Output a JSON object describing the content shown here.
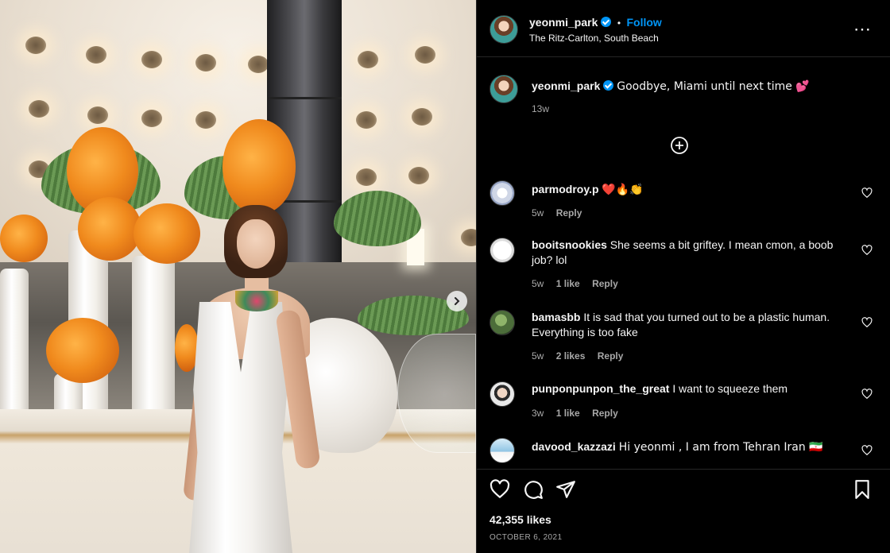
{
  "post": {
    "username": "yeonmi_park",
    "follow_label": "Follow",
    "separator": "•",
    "location": "The Ritz-Carlton, South Beach",
    "caption": "Goodbye, Miami until next time 💕",
    "caption_age": "13w",
    "more_icon": "⋯"
  },
  "comments": [
    {
      "username": "parmodroy.p",
      "text": "❤️🔥👏",
      "age": "5w",
      "likes": "",
      "reply": "Reply"
    },
    {
      "username": "booitsnookies",
      "text": "She seems a bit griftey. I mean cmon, a boob job? lol",
      "age": "5w",
      "likes": "1 like",
      "reply": "Reply"
    },
    {
      "username": "bamasbb",
      "text": "It is sad that you turned out to be a plastic human. Everything is too fake",
      "age": "5w",
      "likes": "2 likes",
      "reply": "Reply"
    },
    {
      "username": "punponpunpon_the_great",
      "text": "I want to squeeze them",
      "age": "3w",
      "likes": "1 like",
      "reply": "Reply"
    },
    {
      "username": "davood_kazzazi",
      "text": "Hi yeonmi , I am from Tehran Iran 🇮🇷",
      "age": "",
      "likes": "",
      "reply": ""
    }
  ],
  "footer": {
    "likes": "42,355 likes",
    "date": "OCTOBER 6, 2021"
  },
  "icons": {
    "verified": "verified-badge-icon",
    "like": "heart-icon",
    "comment": "comment-bubble-icon",
    "share": "paper-plane-icon",
    "save": "bookmark-icon",
    "load_more": "plus-circle-icon",
    "carousel": "chevron-right-icon"
  },
  "colors": {
    "accent": "#0095f6",
    "background": "#000000",
    "text": "#f5f5f5",
    "secondary_text": "#a8a8a8"
  }
}
